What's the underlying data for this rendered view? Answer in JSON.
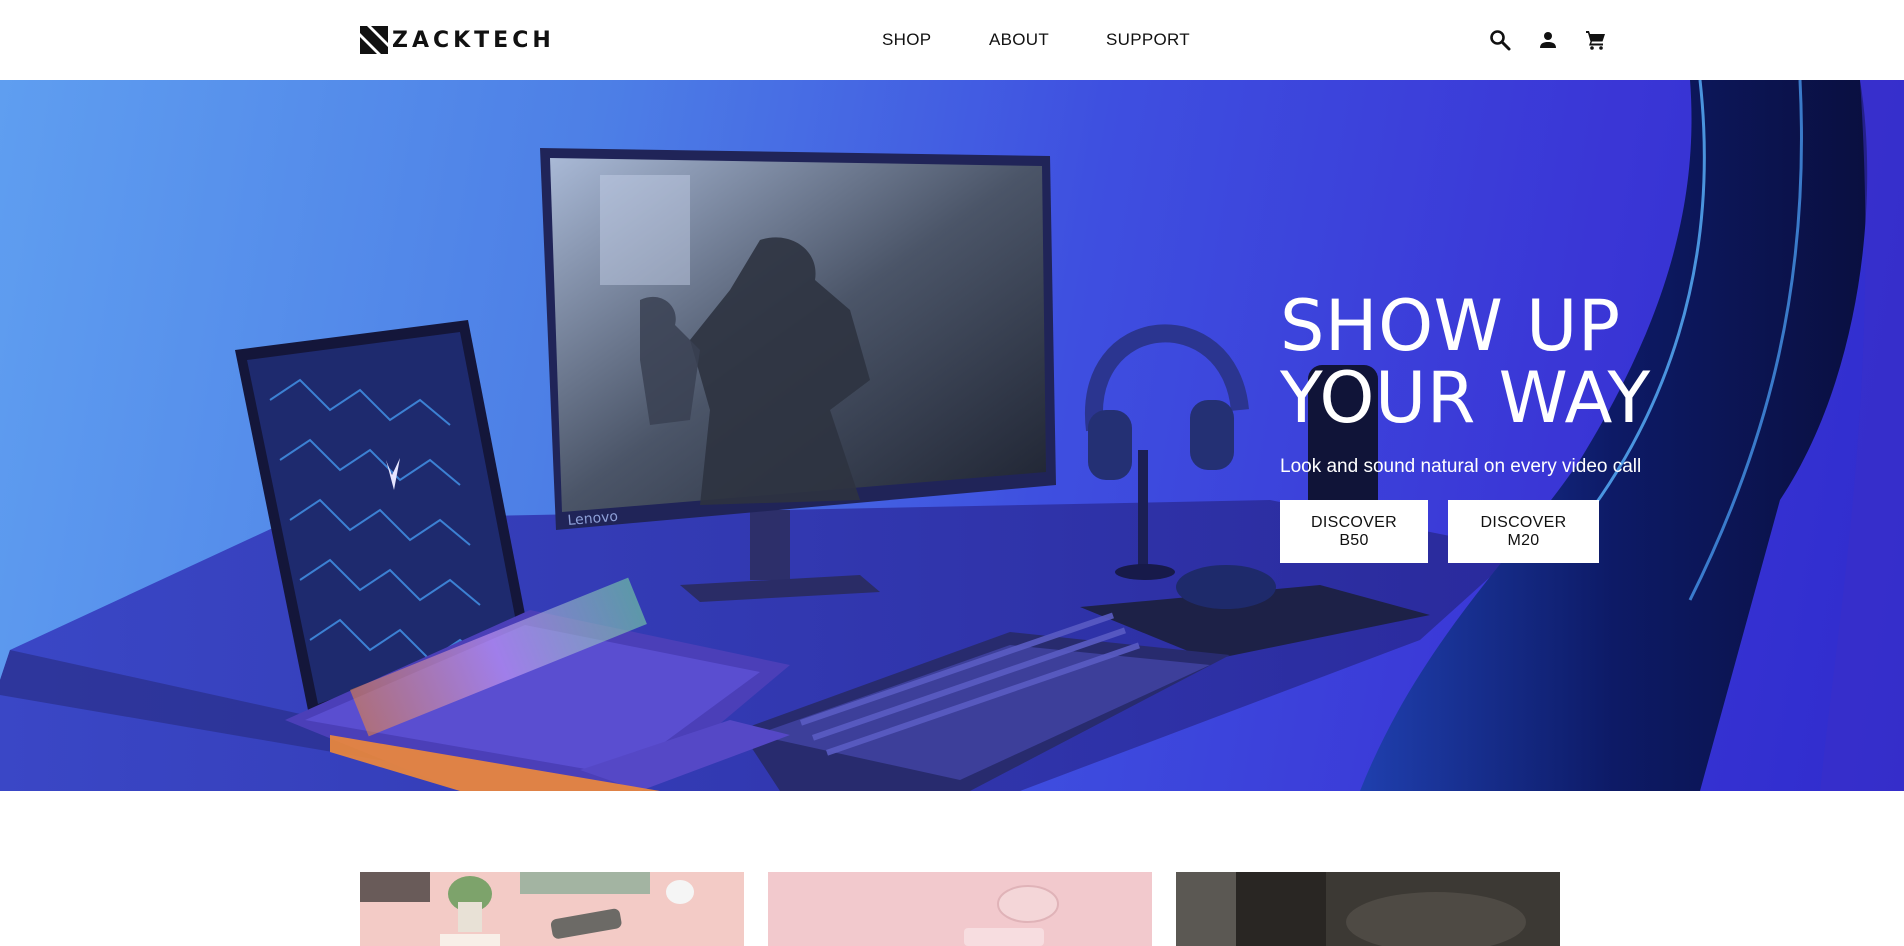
{
  "brand": {
    "name": "ZACKTECH",
    "logo_icon": "zacktech-logo-mark"
  },
  "nav": {
    "items": [
      {
        "label": "SHOP"
      },
      {
        "label": "ABOUT"
      },
      {
        "label": "SUPPORT"
      }
    ]
  },
  "header_icons": [
    "search-icon",
    "account-icon",
    "cart-icon"
  ],
  "hero": {
    "title_line1": "SHOW UP",
    "title_line2": "YOUR WAY",
    "subtitle": "Look and sound natural on every video call",
    "buttons": [
      {
        "label": "DISCOVER B50"
      },
      {
        "label": "DISCOVER M20"
      }
    ],
    "background_colors": [
      "#5f9ef0",
      "#3a36d6"
    ],
    "monitor_brand": "Lenovo"
  },
  "colors": {
    "header_bg": "#ffffff",
    "button_bg": "#ffffff",
    "text_dark": "#111111",
    "text_light": "#ffffff"
  }
}
